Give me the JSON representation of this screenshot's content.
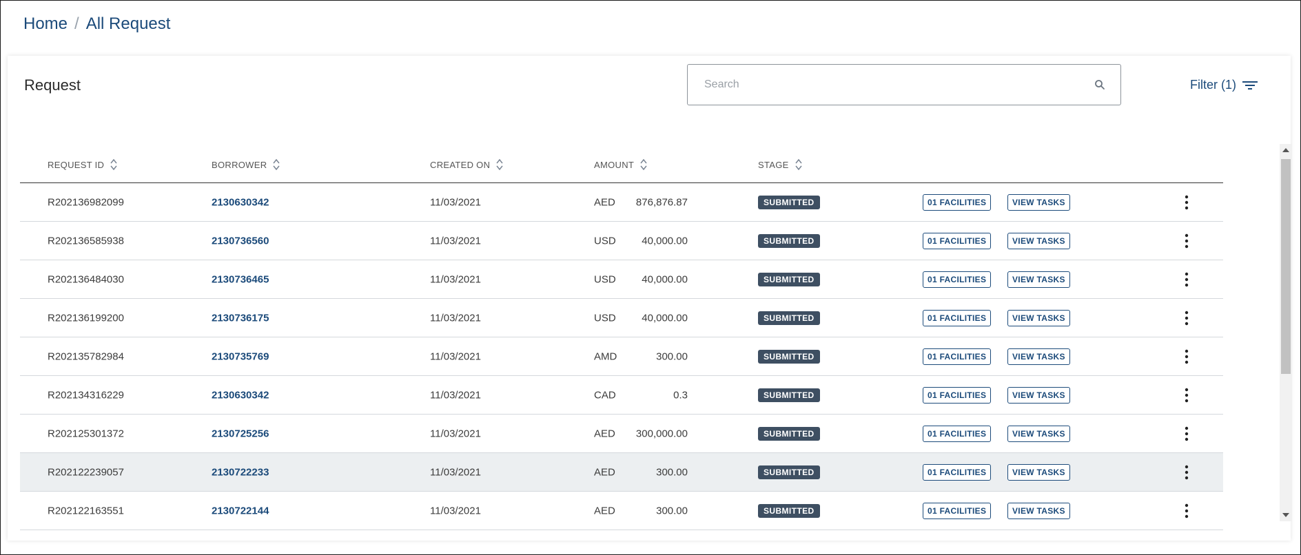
{
  "breadcrumb": {
    "home": "Home",
    "separator": "/",
    "current": "All Request"
  },
  "card": {
    "title": "Request"
  },
  "search": {
    "placeholder": "Search",
    "icon": "search-icon"
  },
  "filter": {
    "label": "Filter (1)",
    "icon": "filter-icon"
  },
  "table": {
    "headers": {
      "request_id": "REQUEST ID",
      "borrower": "BORROWER",
      "created_on": "CREATED ON",
      "amount": "AMOUNT",
      "stage": "STAGE"
    },
    "rows": [
      {
        "request_id": "R202136982099",
        "borrower": "2130630342",
        "created_on": "11/03/2021",
        "currency": "AED",
        "amount": "876,876.87",
        "stage": "SUBMITTED",
        "facilities": "01 FACILITIES",
        "view_tasks": "VIEW TASKS"
      },
      {
        "request_id": "R202136585938",
        "borrower": "2130736560",
        "created_on": "11/03/2021",
        "currency": "USD",
        "amount": "40,000.00",
        "stage": "SUBMITTED",
        "facilities": "01 FACILITIES",
        "view_tasks": "VIEW TASKS"
      },
      {
        "request_id": "R202136484030",
        "borrower": "2130736465",
        "created_on": "11/03/2021",
        "currency": "USD",
        "amount": "40,000.00",
        "stage": "SUBMITTED",
        "facilities": "01 FACILITIES",
        "view_tasks": "VIEW TASKS"
      },
      {
        "request_id": "R202136199200",
        "borrower": "2130736175",
        "created_on": "11/03/2021",
        "currency": "USD",
        "amount": "40,000.00",
        "stage": "SUBMITTED",
        "facilities": "01 FACILITIES",
        "view_tasks": "VIEW TASKS"
      },
      {
        "request_id": "R202135782984",
        "borrower": "2130735769",
        "created_on": "11/03/2021",
        "currency": "AMD",
        "amount": "300.00",
        "stage": "SUBMITTED",
        "facilities": "01 FACILITIES",
        "view_tasks": "VIEW TASKS"
      },
      {
        "request_id": "R202134316229",
        "borrower": "2130630342",
        "created_on": "11/03/2021",
        "currency": "CAD",
        "amount": "0.3",
        "stage": "SUBMITTED",
        "facilities": "01 FACILITIES",
        "view_tasks": "VIEW TASKS"
      },
      {
        "request_id": "R202125301372",
        "borrower": "2130725256",
        "created_on": "11/03/2021",
        "currency": "AED",
        "amount": "300,000.00",
        "stage": "SUBMITTED",
        "facilities": "01 FACILITIES",
        "view_tasks": "VIEW TASKS"
      },
      {
        "request_id": "R202122239057",
        "borrower": "2130722233",
        "created_on": "11/03/2021",
        "currency": "AED",
        "amount": "300.00",
        "stage": "SUBMITTED",
        "facilities": "01 FACILITIES",
        "view_tasks": "VIEW TASKS"
      },
      {
        "request_id": "R202122163551",
        "borrower": "2130722144",
        "created_on": "11/03/2021",
        "currency": "AED",
        "amount": "300.00",
        "stage": "SUBMITTED",
        "facilities": "01 FACILITIES",
        "view_tasks": "VIEW TASKS"
      }
    ]
  },
  "colors": {
    "accent": "#1b4a7a",
    "badge": "#3e4f62",
    "row_highlight": "#eceff1"
  }
}
